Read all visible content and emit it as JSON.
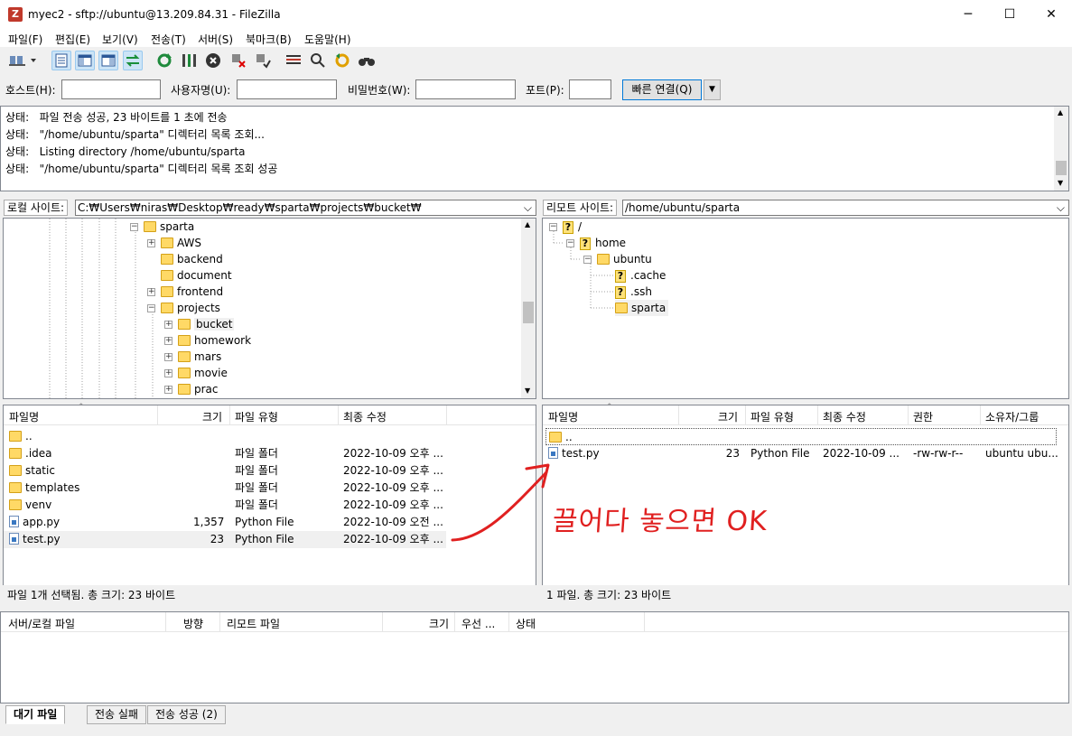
{
  "window": {
    "title": "myec2 - sftp://ubuntu@13.209.84.31 - FileZilla",
    "app_icon": "filezilla-icon",
    "controls": {
      "minimize": "─",
      "maximize": "☐",
      "close": "✕"
    }
  },
  "menu": [
    "파일(F)",
    "편집(E)",
    "보기(V)",
    "전송(T)",
    "서버(S)",
    "북마크(B)",
    "도움말(H)"
  ],
  "quickconnect": {
    "host_label": "호스트(H):",
    "user_label": "사용자명(U):",
    "pass_label": "비밀번호(W):",
    "port_label": "포트(P):",
    "host_value": "",
    "user_value": "",
    "pass_value": "",
    "port_value": "",
    "connect_label": "빠른 연결(Q)"
  },
  "log": [
    {
      "label": "상태:",
      "text": "파일 전송 성공, 23 바이트를 1 초에 전송"
    },
    {
      "label": "상태:",
      "text": "\"/home/ubuntu/sparta\" 디렉터리 목록 조회..."
    },
    {
      "label": "상태:",
      "text": "Listing directory /home/ubuntu/sparta"
    },
    {
      "label": "상태:",
      "text": "\"/home/ubuntu/sparta\" 디렉터리 목록 조회 성공"
    }
  ],
  "local": {
    "site_label": "로컬 사이트:",
    "path": "C:₩Users₩niras₩Desktop₩ready₩sparta₩projects₩bucket₩",
    "tree": [
      {
        "name": "sparta",
        "expander": "−"
      },
      {
        "name": "AWS",
        "expander": "+"
      },
      {
        "name": "backend",
        "expander": ""
      },
      {
        "name": "document",
        "expander": ""
      },
      {
        "name": "frontend",
        "expander": "+"
      },
      {
        "name": "projects",
        "expander": "−"
      },
      {
        "name": "bucket",
        "expander": "+"
      },
      {
        "name": "homework",
        "expander": "+"
      },
      {
        "name": "mars",
        "expander": "+"
      },
      {
        "name": "movie",
        "expander": "+"
      },
      {
        "name": "prac",
        "expander": "+"
      }
    ],
    "columns": {
      "name": "파일명",
      "size": "크기",
      "type": "파일 유형",
      "modified": "최종 수정"
    },
    "files": [
      {
        "name": "..",
        "size": "",
        "type": "",
        "modified": "",
        "icon": "folder"
      },
      {
        "name": ".idea",
        "size": "",
        "type": "파일 폴더",
        "modified": "2022-10-09 오후 ...",
        "icon": "folder"
      },
      {
        "name": "static",
        "size": "",
        "type": "파일 폴더",
        "modified": "2022-10-09 오후 ...",
        "icon": "folder"
      },
      {
        "name": "templates",
        "size": "",
        "type": "파일 폴더",
        "modified": "2022-10-09 오후 ...",
        "icon": "folder"
      },
      {
        "name": "venv",
        "size": "",
        "type": "파일 폴더",
        "modified": "2022-10-09 오후 ...",
        "icon": "folder"
      },
      {
        "name": "app.py",
        "size": "1,357",
        "type": "Python File",
        "modified": "2022-10-09 오전 ...",
        "icon": "py"
      },
      {
        "name": "test.py",
        "size": "23",
        "type": "Python File",
        "modified": "2022-10-09 오후 ...",
        "icon": "py"
      }
    ],
    "status": "파일 1개 선택됨. 총 크기: 23 바이트"
  },
  "remote": {
    "site_label": "리모트 사이트:",
    "path": "/home/ubuntu/sparta",
    "tree": [
      {
        "name": "/",
        "icon": "question"
      },
      {
        "name": "home",
        "icon": "question"
      },
      {
        "name": "ubuntu",
        "icon": "folder"
      },
      {
        "name": ".cache",
        "icon": "question"
      },
      {
        "name": ".ssh",
        "icon": "question"
      },
      {
        "name": "sparta",
        "icon": "folder"
      }
    ],
    "columns": {
      "name": "파일명",
      "size": "크기",
      "type": "파일 유형",
      "modified": "최종 수정",
      "perm": "권한",
      "owner": "소유자/그룹"
    },
    "files": [
      {
        "name": "..",
        "size": "",
        "type": "",
        "modified": "",
        "perm": "",
        "owner": "",
        "icon": "folder"
      },
      {
        "name": "test.py",
        "size": "23",
        "type": "Python File",
        "modified": "2022-10-09 ...",
        "perm": "-rw-rw-r--",
        "owner": "ubuntu ubu...",
        "icon": "py"
      }
    ],
    "status": "1 파일. 총 크기: 23 바이트"
  },
  "annotation": {
    "text": "끌어다 놓으면 OK",
    "color": "#e02020"
  },
  "queue": {
    "columns": {
      "local": "서버/로컬 파일",
      "dir": "방향",
      "remote": "리모트 파일",
      "size": "크기",
      "prio": "우선 ...",
      "status": "상태"
    }
  },
  "tabs": [
    "대기 파일",
    "전송 실패",
    "전송 성공 (2)"
  ]
}
